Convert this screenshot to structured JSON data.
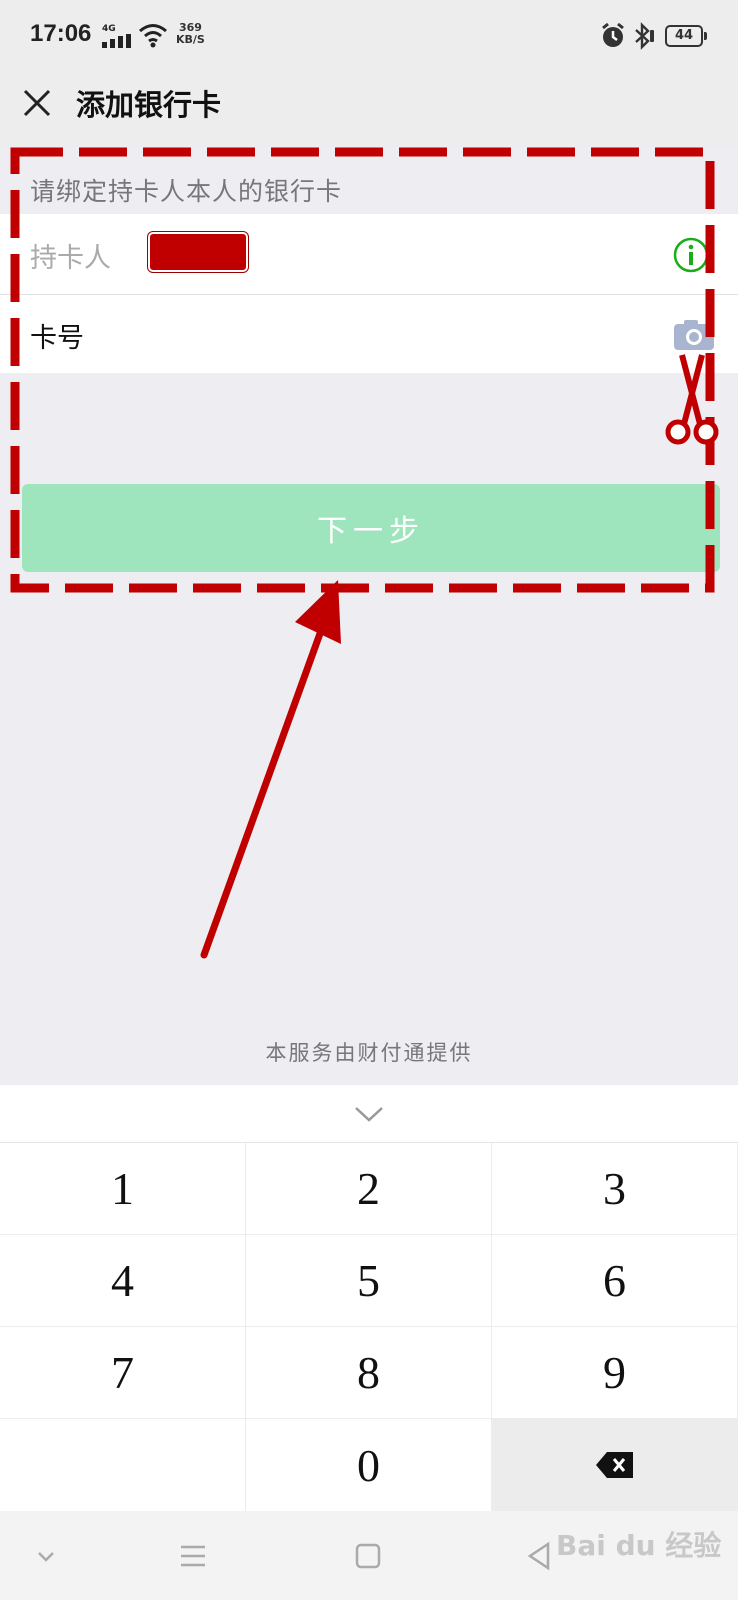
{
  "status_bar": {
    "time": "17:06",
    "network": "4G",
    "speed_value": "369",
    "speed_unit": "KB/S",
    "battery": "44"
  },
  "header": {
    "title": "添加银行卡"
  },
  "form": {
    "hint": "请绑定持卡人本人的银行卡",
    "holder_label": "持卡人",
    "card_label": "卡号",
    "next_label": "下一步"
  },
  "footer": {
    "provider": "本服务由财付通提供"
  },
  "keypad": {
    "keys": [
      "1",
      "2",
      "3",
      "4",
      "5",
      "6",
      "7",
      "8",
      "9",
      "",
      "0",
      "⌫"
    ]
  },
  "watermark": "Bai du 经验",
  "colors": {
    "next_button": "#9ee5bd",
    "annotation_red": "#c00000",
    "info_green": "#1aad19"
  }
}
